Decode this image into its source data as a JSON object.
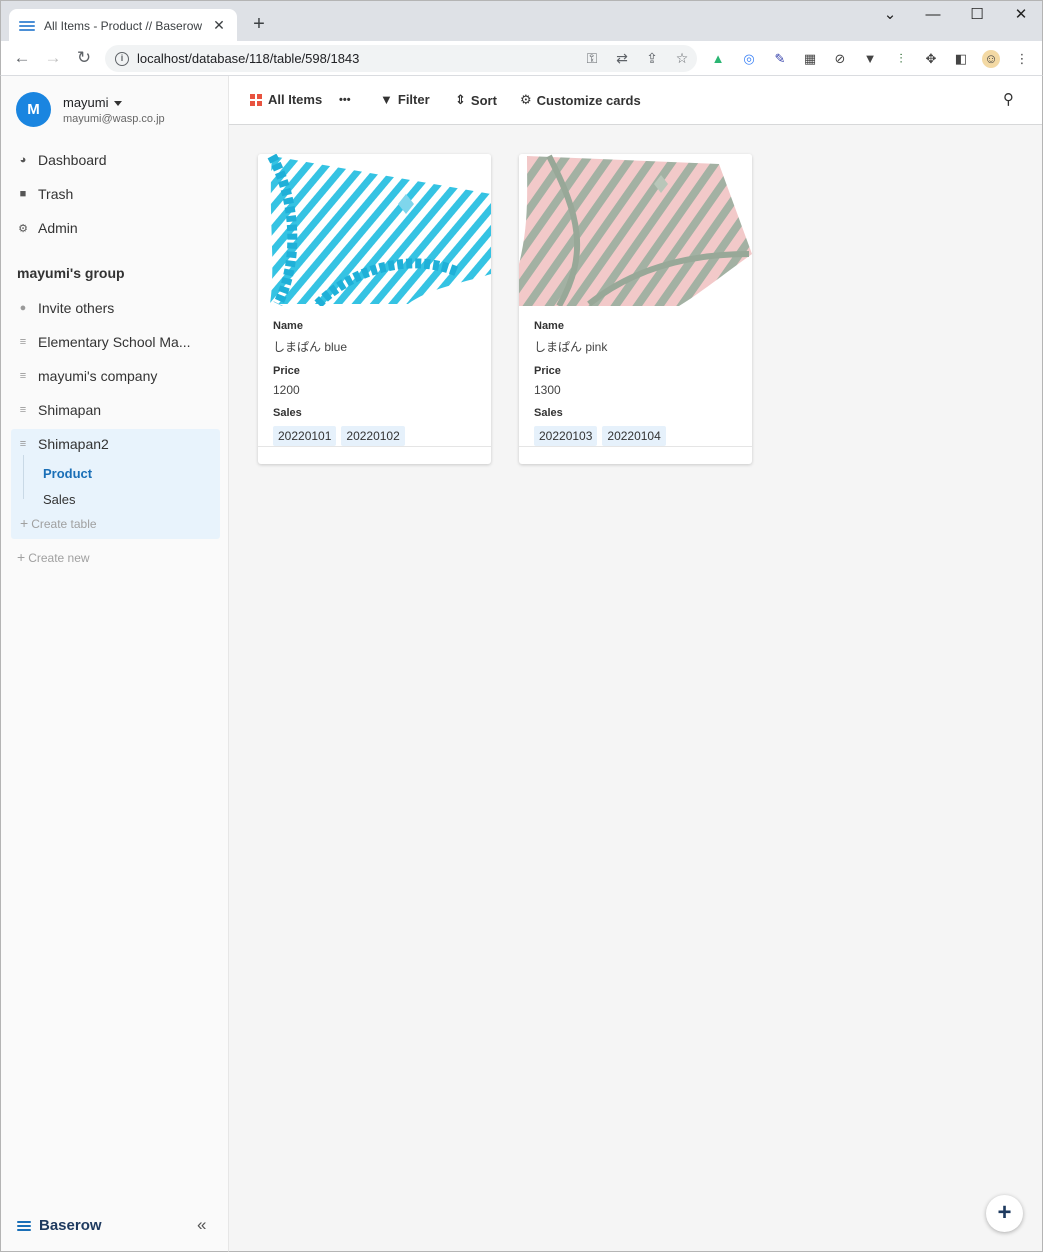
{
  "browser": {
    "tab_title": "All Items - Product // Baserow",
    "tab_close": "✕",
    "new_tab": "+",
    "url": "localhost/database/118/table/598/1843",
    "window": {
      "dropdown": "⌄",
      "minimize": "—",
      "maximize": "☐",
      "close": "✕"
    }
  },
  "sidebar": {
    "user": {
      "initial": "M",
      "name": "mayumi",
      "email": "mayumi@wasp.co.jp"
    },
    "nav": [
      {
        "label": "Dashboard",
        "icon": "dashboard-icon"
      },
      {
        "label": "Trash",
        "icon": "trash-icon"
      },
      {
        "label": "Admin",
        "icon": "users-cog-icon"
      }
    ],
    "group_title": "mayumi's group",
    "invite_label": "Invite others",
    "databases": [
      {
        "label": "Elementary School Ma..."
      },
      {
        "label": "mayumi's company"
      },
      {
        "label": "Shimapan"
      },
      {
        "label": "Shimapan2"
      }
    ],
    "tables": [
      {
        "label": "Product",
        "active": true
      },
      {
        "label": "Sales",
        "active": false
      }
    ],
    "create_table": "Create table",
    "create_new": "Create new",
    "brand": "Baserow",
    "collapse": "«"
  },
  "header": {
    "view_name": "All Items",
    "more": "•••",
    "filter": "Filter",
    "sort": "Sort",
    "customize": "Customize cards"
  },
  "cards": [
    {
      "color": "#35c3e3",
      "name_label": "Name",
      "name": "しまぱん blue",
      "price_label": "Price",
      "price": "1200",
      "sales_label": "Sales",
      "sales": [
        "20220101",
        "20220102"
      ]
    },
    {
      "color": "#e9b3b3",
      "name_label": "Name",
      "name": "しまぱん pink",
      "price_label": "Price",
      "price": "1300",
      "sales_label": "Sales",
      "sales": [
        "20220103",
        "20220104"
      ]
    }
  ],
  "fab": "+"
}
